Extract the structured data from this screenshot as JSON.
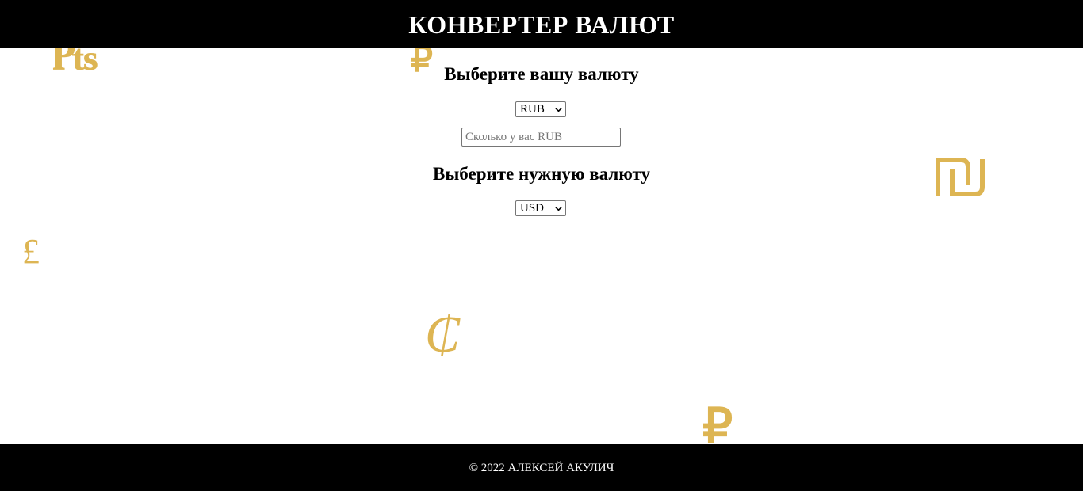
{
  "header": {
    "title": "КОНВЕРТЕР ВАЛЮТ"
  },
  "converter": {
    "from_heading": "Выберите вашу валюту",
    "from_currency": "RUB",
    "amount_placeholder": "Сколько у вас RUB",
    "amount_value": "",
    "to_heading": "Выберите нужную валюту",
    "to_currency": "USD"
  },
  "background_symbols": {
    "pts": "₧",
    "ruble_top": "₽",
    "shekel": "₪",
    "pound": "£",
    "cent": "₵",
    "ruble_bottom": "₽"
  },
  "footer": {
    "copyright": "© 2022 АЛЕКСЕЙ АКУЛИЧ"
  },
  "colors": {
    "bar_background": "#000000",
    "bar_text": "#ffffff",
    "page_background": "#ffffff",
    "symbol_gold": "#ddb553"
  },
  "icons": {
    "dropdown": "chevron-down-icon",
    "shekel_symbol": "shekel-icon"
  }
}
